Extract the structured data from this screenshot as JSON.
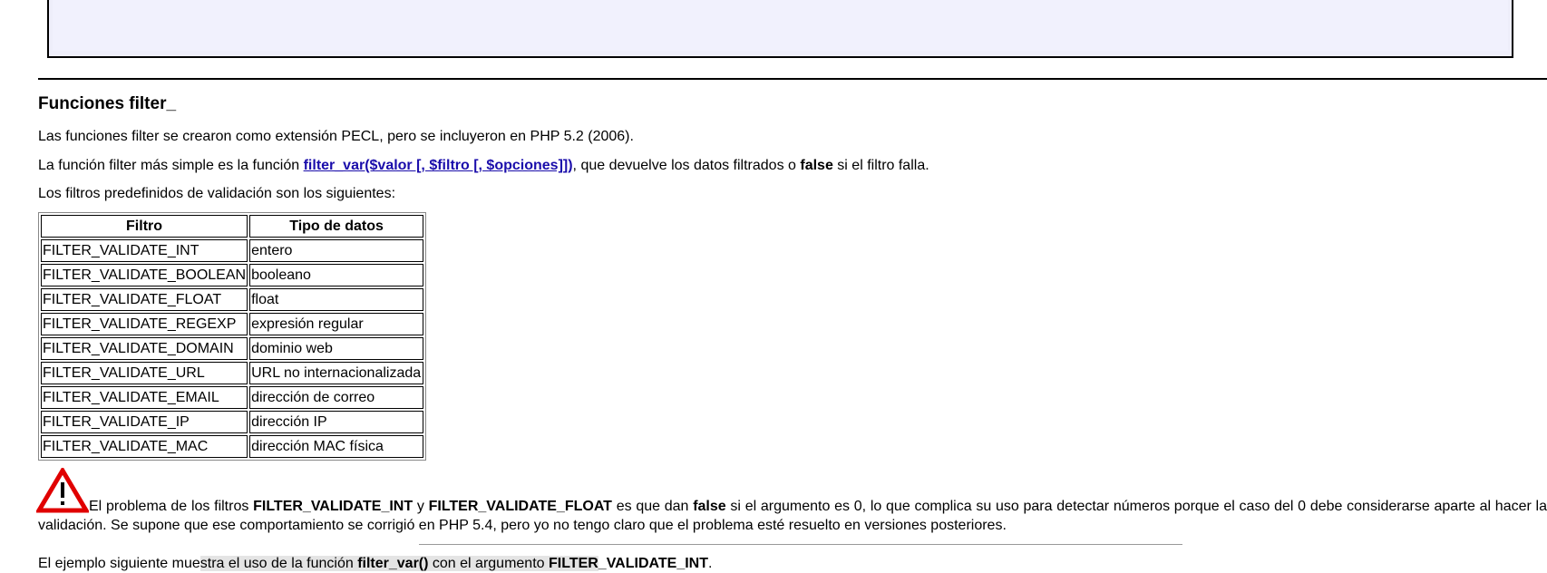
{
  "section": {
    "title": "Funciones filter_",
    "intro": "Las funciones filter se crearon como extensión PECL, pero se incluyeron en PHP 5.2 (2006).",
    "simple_prefix": "La función filter más simple es la función ",
    "simple_link": "filter_var($valor [, $filtro [, $opciones]])",
    "simple_mid": ", que devuelve los datos filtrados o ",
    "simple_false": "false",
    "simple_suffix": " si el filtro falla.",
    "validation_intro": "Los filtros predefinidos de validación son los siguientes:"
  },
  "table": {
    "headers": [
      "Filtro",
      "Tipo de datos"
    ],
    "rows": [
      [
        "FILTER_VALIDATE_INT",
        "entero"
      ],
      [
        "FILTER_VALIDATE_BOOLEAN",
        "booleano"
      ],
      [
        "FILTER_VALIDATE_FLOAT",
        "float"
      ],
      [
        "FILTER_VALIDATE_REGEXP",
        "expresión regular"
      ],
      [
        "FILTER_VALIDATE_DOMAIN",
        "dominio web"
      ],
      [
        "FILTER_VALIDATE_URL",
        "URL no internacionalizada"
      ],
      [
        "FILTER_VALIDATE_EMAIL",
        "dirección de correo"
      ],
      [
        "FILTER_VALIDATE_IP",
        "dirección IP"
      ],
      [
        "FILTER_VALIDATE_MAC",
        "dirección MAC física"
      ]
    ]
  },
  "warning": {
    "icon": "warning-triangle-icon",
    "icon_color": "#e00000",
    "t1": "El problema de los filtros ",
    "b1": "FILTER_VALIDATE_INT",
    "t2": " y ",
    "b2": "FILTER_VALIDATE_FLOAT",
    "t3": " es que dan ",
    "b3": "false",
    "t4": " si el argumento es 0, lo que complica su uso para detectar números porque el caso del 0 debe considerarse aparte al hacer la validación. Se supone que ese comportamiento se corrigió en PHP 5.4, pero yo no tengo claro que el problema esté resuelto en versiones posteriores."
  },
  "example": {
    "t1": "El ejemplo siguiente mue",
    "t2": "stra el uso de la función ",
    "b1": "filter_var()",
    "t3": " con el argumento ",
    "b2a": "FILTER",
    "b2b": "_VALIDATE_INT",
    "t4": "."
  }
}
